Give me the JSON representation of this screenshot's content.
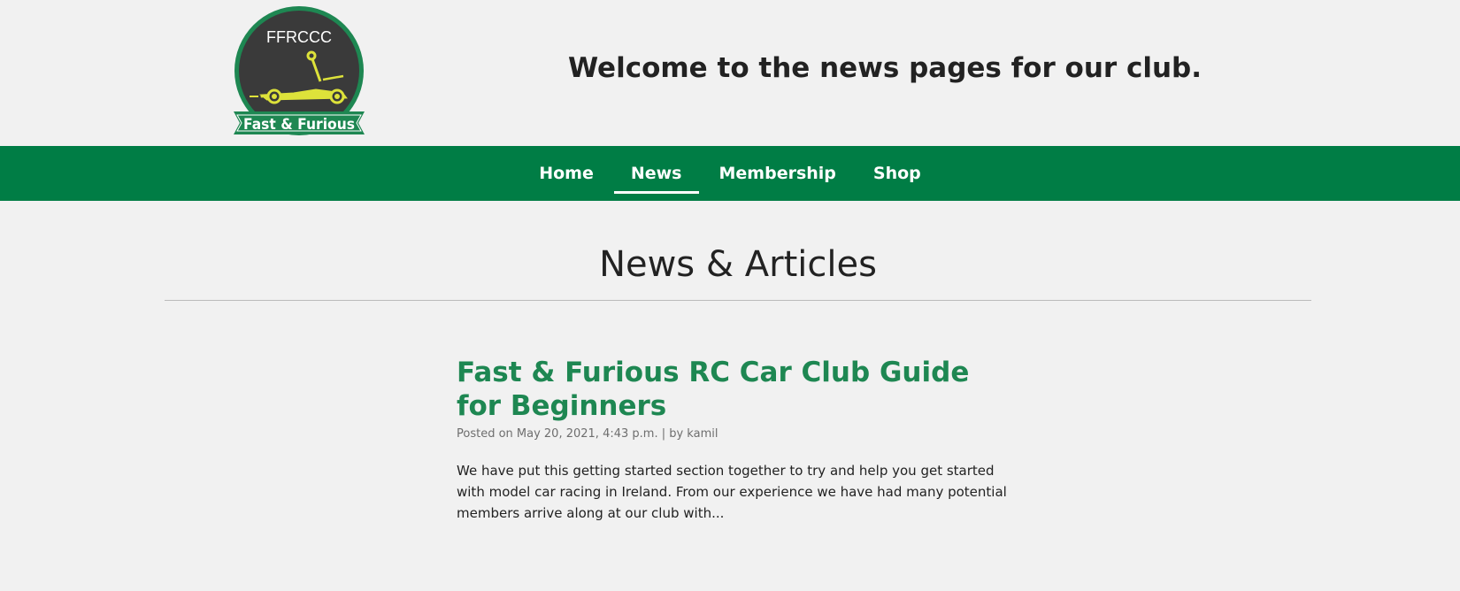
{
  "header": {
    "logo_top_text": "FFRCCC",
    "logo_banner_text": "Fast & Furious",
    "welcome": "Welcome to the news pages for our club."
  },
  "nav": {
    "items": [
      {
        "label": "Home",
        "active": false
      },
      {
        "label": "News",
        "active": true
      },
      {
        "label": "Membership",
        "active": false
      },
      {
        "label": "Shop",
        "active": false
      }
    ]
  },
  "main": {
    "heading": "News & Articles",
    "articles": [
      {
        "title": "Fast & Furious RC Car Club Guide for Beginners",
        "meta": "Posted on May 20, 2021, 4:43 p.m. | by kamil",
        "excerpt": "We have put this getting started section together to try and help you get started with model car racing in Ireland. From our experience we have had many potential members arrive along at our club with..."
      }
    ]
  },
  "colors": {
    "brand_green": "#007d45",
    "title_green": "#1e8752",
    "logo_dark": "#3a3a3a",
    "logo_car": "#dde23a"
  }
}
